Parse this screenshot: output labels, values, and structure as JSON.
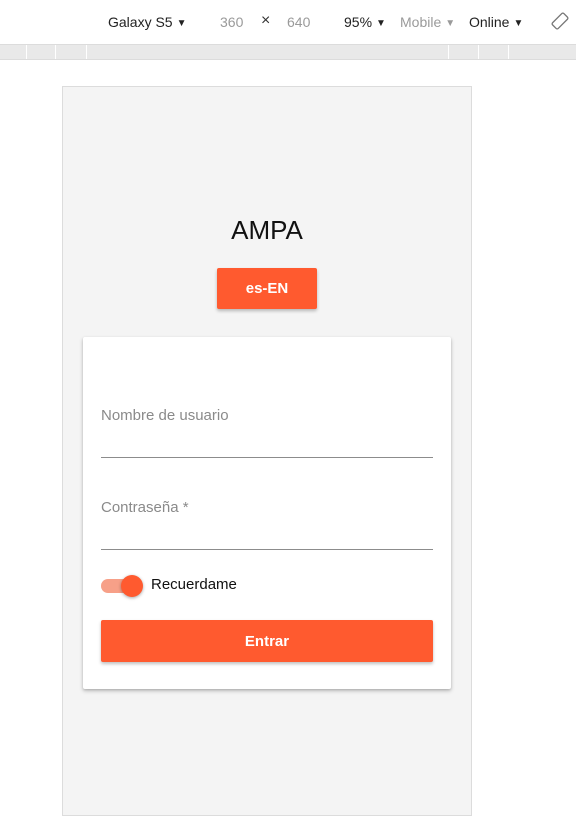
{
  "devtools": {
    "device": "Galaxy S5",
    "width": "360",
    "times": "×",
    "height": "640",
    "zoom": "95%",
    "throttle": "Mobile",
    "network": "Online",
    "caret": "▼"
  },
  "app": {
    "title": "AMPA",
    "lang_button": "es-EN",
    "accent_color": "#ff5a2f"
  },
  "login": {
    "username_label": "Nombre de usuario",
    "password_label": "Contraseña *",
    "remember_label": "Recuerdame",
    "remember_checked": true,
    "submit_label": "Entrar"
  }
}
